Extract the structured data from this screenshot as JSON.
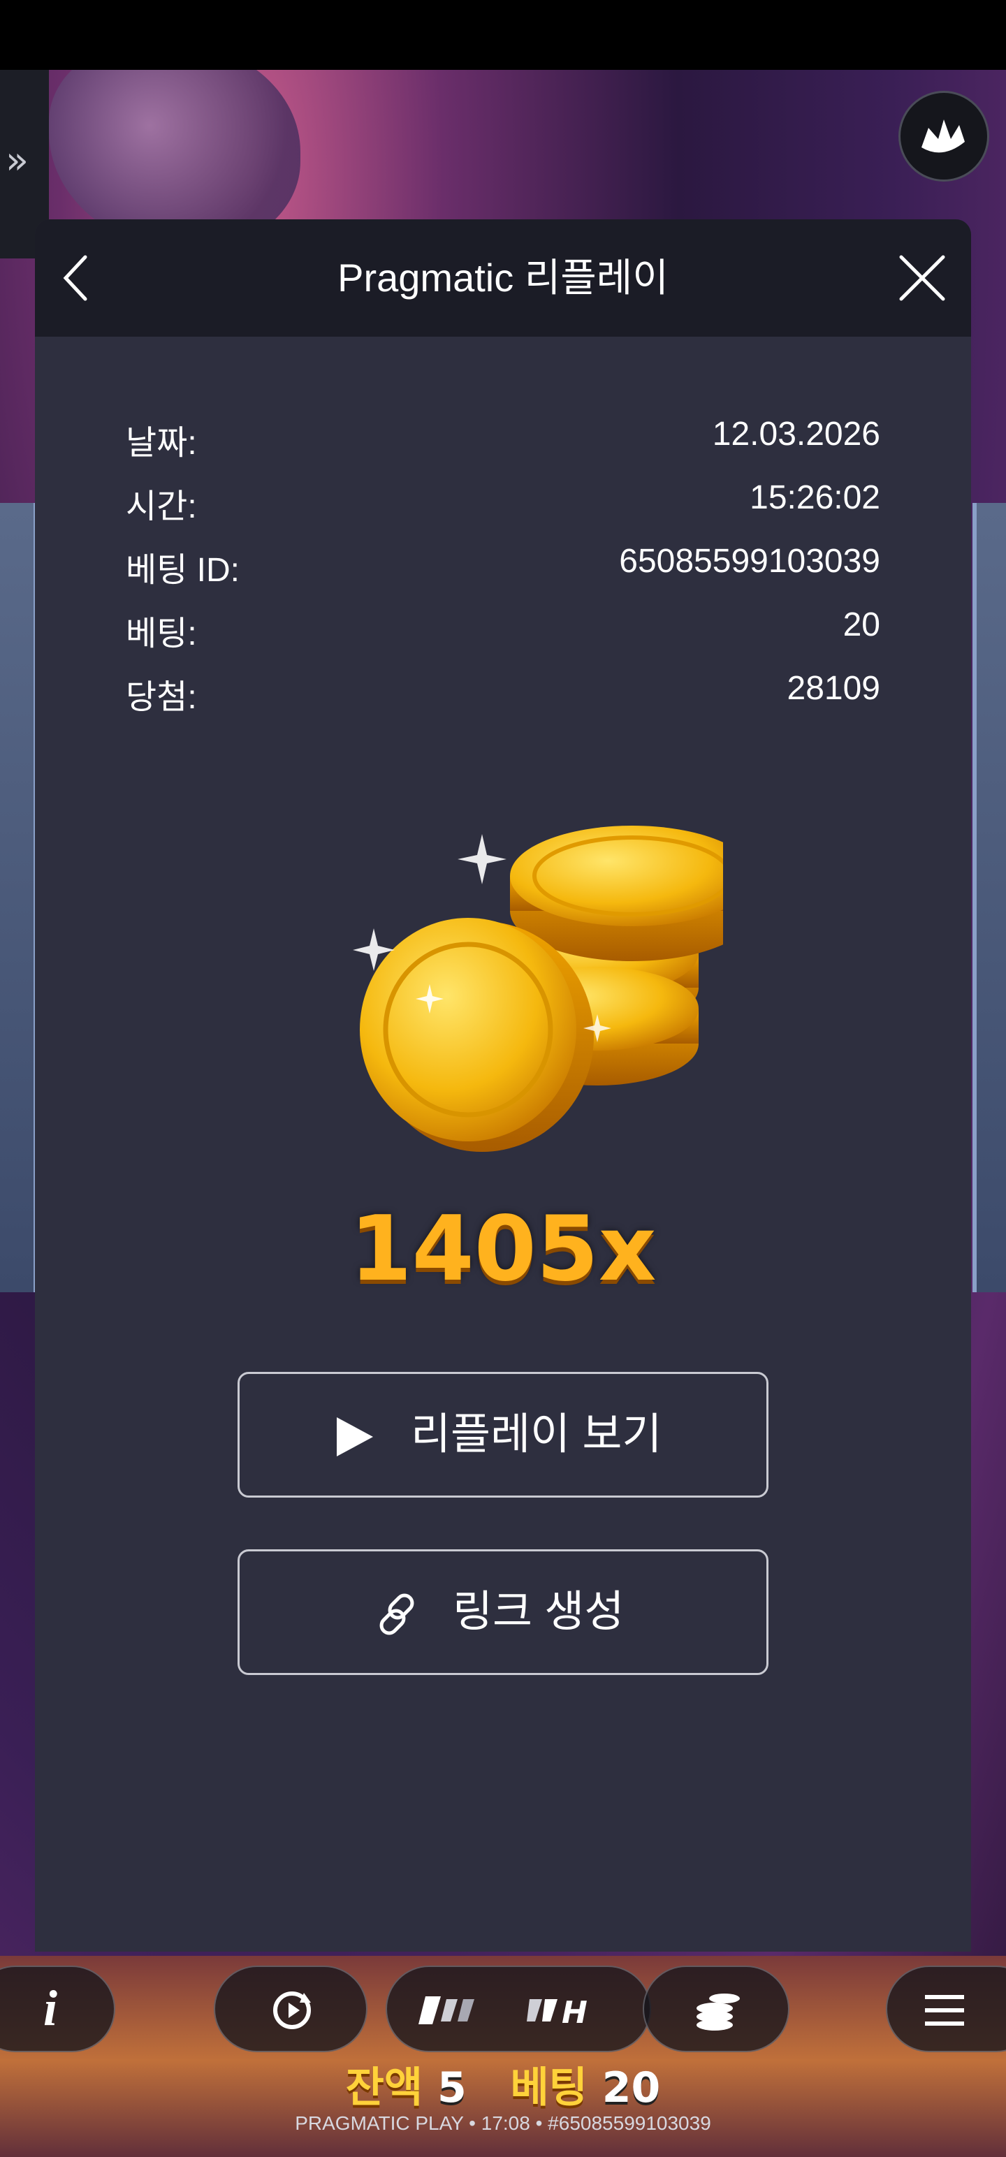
{
  "modal": {
    "title": "Pragmatic 리플레이",
    "details": [
      {
        "label": "날짜:",
        "value": "12.03.2026"
      },
      {
        "label": "시간:",
        "value": "15:26:02"
      },
      {
        "label": "베팅 ID:",
        "value": "65085599103039"
      },
      {
        "label": "베팅:",
        "value": "20"
      },
      {
        "label": "당첨:",
        "value": "28109"
      }
    ],
    "multiplier": "1405x",
    "watch_replay_label": "리플레이 보기",
    "create_link_label": "링크 생성"
  },
  "game": {
    "info_icon": "i",
    "balance_label": "잔액",
    "balance_value": "5",
    "bet_label": "베팅",
    "bet_value": "20",
    "footer": "PRAGMATIC PLAY • 17:08 • #65085599103039"
  },
  "colors": {
    "modal_bg": "#2e2f3f",
    "header_bg": "#1b1c26",
    "multiplier": "#ffb21e",
    "balance_label": "#ffd23a"
  }
}
